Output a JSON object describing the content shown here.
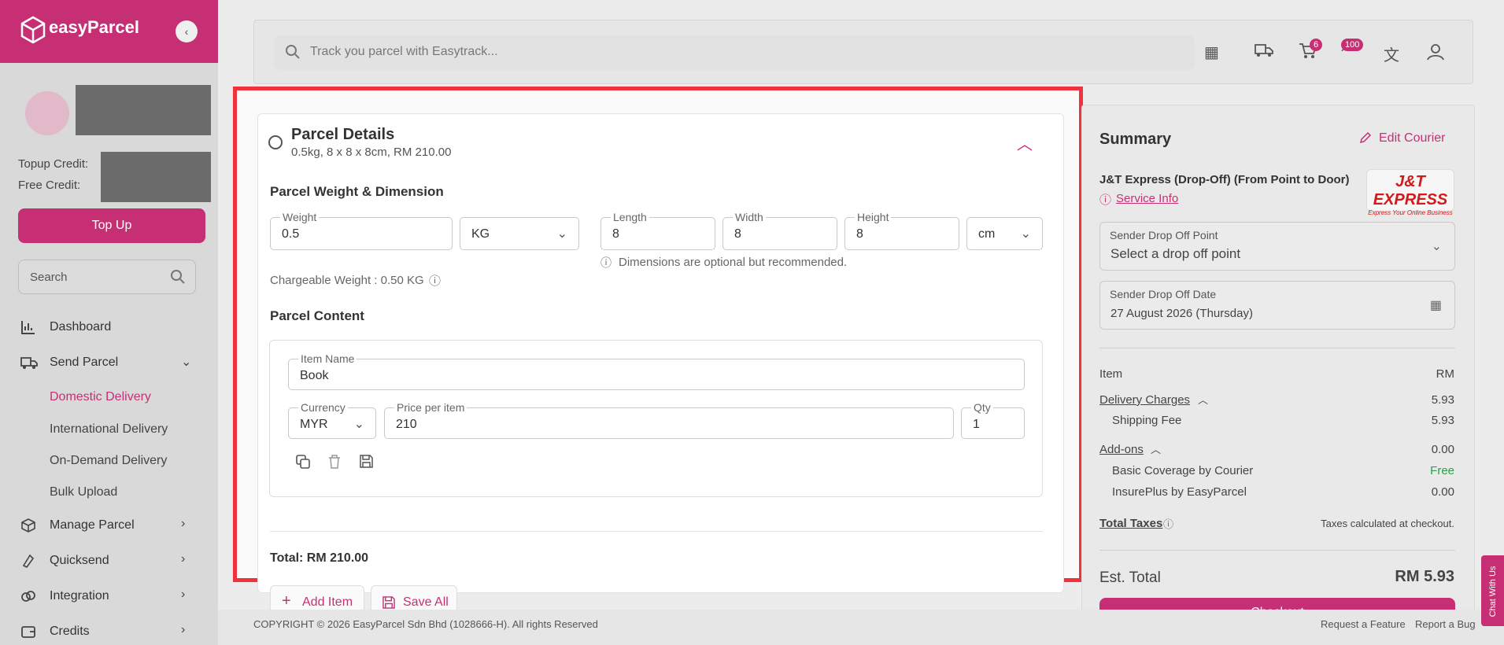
{
  "sidebar": {
    "brand": "easyParcel",
    "topup_credit_label": "Topup Credit:",
    "free_credit_label": "Free Credit:",
    "topup_button": "Top Up",
    "search_placeholder": "Search",
    "nav": [
      {
        "label": "Dashboard",
        "icon": "bar-chart-icon"
      },
      {
        "label": "Send Parcel",
        "icon": "truck-icon",
        "expanded": true
      },
      {
        "label": "Manage Parcel",
        "icon": "box-icon"
      },
      {
        "label": "Quicksend",
        "icon": "lightning-icon"
      },
      {
        "label": "Integration",
        "icon": "link-icon"
      },
      {
        "label": "Credits",
        "icon": "wallet-icon"
      }
    ],
    "send_parcel_sub": [
      "Domestic Delivery",
      "International Delivery",
      "On-Demand Delivery",
      "Bulk Upload"
    ],
    "active_sub": "Domestic Delivery"
  },
  "header": {
    "track_placeholder": "Track you parcel with Easytrack...",
    "cart_count": "6",
    "points_count": "100"
  },
  "parcel": {
    "title": "Parcel Details",
    "subtitle": "0.5kg, 8 x 8 x 8cm, RM 210.00",
    "weight_dim_title": "Parcel Weight & Dimension",
    "weight_label": "Weight",
    "weight_value": "0.5",
    "weight_unit": "KG",
    "length_label": "Length",
    "length_value": "8",
    "width_label": "Width",
    "width_value": "8",
    "height_label": "Height",
    "height_value": "8",
    "dim_unit": "cm",
    "dim_note": "Dimensions are optional but recommended.",
    "chargeable": "Chargeable Weight : 0.50 KG",
    "content_title": "Parcel Content",
    "item_name_label": "Item Name",
    "item_name_value": "Book",
    "currency_label": "Currency",
    "currency_value": "MYR",
    "price_label": "Price per item",
    "price_value": "210",
    "qty_label": "Qty",
    "qty_value": "1",
    "total": "Total: RM 210.00",
    "add_item": "Add Item",
    "save_all": "Save All"
  },
  "summary": {
    "title": "Summary",
    "edit_courier": "Edit Courier",
    "courier": "J&T Express (Drop-Off) (From Point to Door)",
    "service_info": "Service Info",
    "courier_logo_text": "J&T EXPRESS",
    "courier_logo_tagline": "Express Your Online Business",
    "drop_point_label": "Sender Drop Off Point",
    "drop_point_value": "Select a drop off point",
    "drop_date_label": "Sender Drop Off Date",
    "drop_date_value": "27 August 2026 (Thursday)",
    "item_label": "Item",
    "currency": "RM",
    "delivery_charges_label": "Delivery Charges",
    "delivery_charges": "5.93",
    "shipping_fee_label": "Shipping Fee",
    "shipping_fee": "5.93",
    "addons_label": "Add-ons",
    "addons": "0.00",
    "basic_coverage_label": "Basic Coverage by Courier",
    "basic_coverage": "Free",
    "insureplus_label": "InsurePlus by EasyParcel",
    "insureplus": "0.00",
    "total_taxes_label": "Total Taxes",
    "taxes_note": "Taxes calculated at checkout.",
    "est_total_label": "Est. Total",
    "est_total": "RM 5.93",
    "checkout": "Checkout"
  },
  "footer": {
    "copyright": "COPYRIGHT © 2026 EasyParcel Sdn Bhd (1028666-H). All rights Reserved",
    "request_feature": "Request a Feature",
    "report_bug": "Report a Bug"
  },
  "chat": "Chat With Us",
  "colors": {
    "brand": "#c72f74",
    "highlight": "#f1323b",
    "free": "#2e9e4a"
  }
}
